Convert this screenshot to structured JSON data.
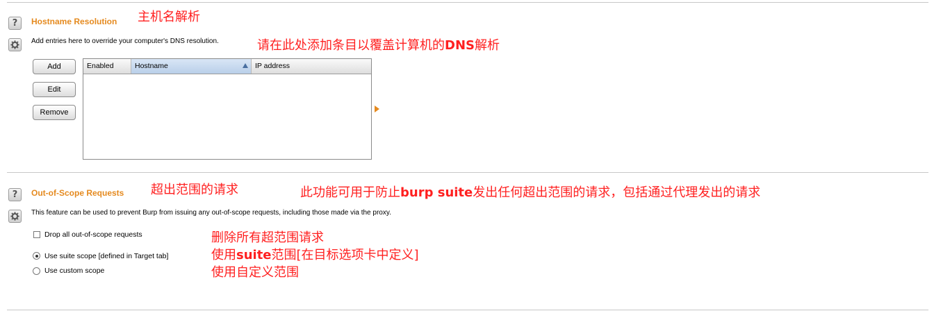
{
  "colors": {
    "accent": "#e58a1f",
    "annotation": "#ff2020"
  },
  "hostname_section": {
    "title": "Hostname Resolution",
    "title_annotation": "主机名解析",
    "description": "Add entries here to override your computer's DNS resolution.",
    "description_annotation_pre": "请在此处添加条目以覆盖计算机的",
    "description_annotation_bold": "DNS",
    "description_annotation_post": "解析",
    "buttons": {
      "add": "Add",
      "edit": "Edit",
      "remove": "Remove"
    },
    "table": {
      "columns": [
        "Enabled",
        "Hostname",
        "IP address"
      ],
      "sorted_column": "Hostname",
      "rows": []
    }
  },
  "scope_section": {
    "title": "Out-of-Scope Requests",
    "title_annotation": "超出范围的请求",
    "feature_annotation_pre": "此功能可用于防止",
    "feature_annotation_bold": "burp suite",
    "feature_annotation_post": "发出任何超出范围的请求，包括通过代理发出的请求",
    "description": "This feature can be used to prevent Burp from issuing any out-of-scope requests, including those made via the proxy.",
    "options": {
      "drop": {
        "label": "Drop all out-of-scope requests",
        "checked": false,
        "annotation": "删除所有超范围请求"
      },
      "suite_scope": {
        "label": "Use suite scope [defined in Target tab]",
        "selected": true,
        "annotation_pre": "使用",
        "annotation_bold": "suite",
        "annotation_post": "范围[在目标选项卡中定义]"
      },
      "custom_scope": {
        "label": "Use custom scope",
        "selected": false,
        "annotation": "使用自定义范围"
      }
    }
  }
}
